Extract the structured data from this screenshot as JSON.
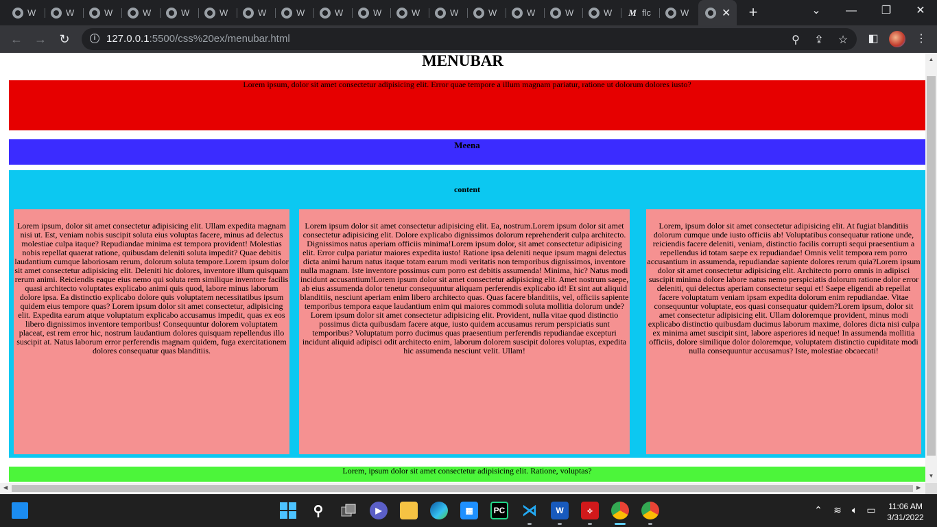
{
  "browser": {
    "tabs": [
      {
        "label": "W",
        "icon": "globe-icon"
      },
      {
        "label": "W",
        "icon": "globe-icon"
      },
      {
        "label": "W",
        "icon": "globe-icon"
      },
      {
        "label": "W",
        "icon": "globe-icon"
      },
      {
        "label": "W",
        "icon": "globe-icon"
      },
      {
        "label": "W",
        "icon": "globe-icon"
      },
      {
        "label": "W",
        "icon": "globe-icon"
      },
      {
        "label": "W",
        "icon": "globe-icon"
      },
      {
        "label": "W",
        "icon": "globe-icon"
      },
      {
        "label": "W",
        "icon": "globe-icon"
      },
      {
        "label": "W",
        "icon": "globe-icon"
      },
      {
        "label": "W",
        "icon": "globe-icon"
      },
      {
        "label": "W",
        "icon": "globe-icon"
      },
      {
        "label": "W",
        "icon": "globe-icon"
      },
      {
        "label": "W",
        "icon": "globe-icon"
      },
      {
        "label": "W",
        "icon": "globe-icon"
      },
      {
        "label": "flc",
        "icon": "m-logo-icon",
        "icon_text": "M"
      },
      {
        "label": "W",
        "icon": "globe-icon"
      }
    ],
    "active_tab": {
      "icon": "globe-icon",
      "close": "✕"
    },
    "new_tab": "+",
    "url_host": "127.0.0.1",
    "url_rest": ":5500/css%20ex/menubar.html"
  },
  "page": {
    "title": "MENUBAR",
    "header_text": "Lorem ipsum, dolor sit amet consectetur adipisicing elit. Error quae tempore a illum magnam pariatur, ratione ut dolorum dolores iusto?",
    "nav_text": "Meena",
    "content_heading": "content",
    "columns": [
      "Lorem ipsum, dolor sit amet consectetur adipisicing elit. Ullam expedita magnam nisi ut. Est, veniam nobis suscipit soluta eius voluptas facere, minus ad delectus molestiae culpa itaque? Repudiandae minima est tempora provident! Molestias nobis repellat quaerat ratione, quibusdam deleniti soluta impedit? Quae debitis laudantium cumque laboriosam rerum, dolorum soluta tempore.Lorem ipsum dolor sit amet consectetur adipisicing elit. Deleniti hic dolores, inventore illum quisquam rerum animi. Reiciendis eaque eius nemo qui soluta rem similique inventore facilis quasi architecto voluptates explicabo animi quis quod, labore minus laborum dolore ipsa. Ea distinctio explicabo dolore quis voluptatem necessitatibus ipsum quidem eius tempore quas? Lorem ipsum dolor sit amet consectetur, adipisicing elit. Expedita earum atque voluptatum explicabo accusamus impedit, quas ex eos libero dignissimos inventore temporibus! Consequuntur dolorem voluptatem placeat, est rem error hic, nostrum laudantium dolores quisquam repellendus illo suscipit at. Natus laborum error perferendis magnam quidem, fuga exercitationem dolores consequatur quas blanditiis.",
      "Lorem ipsum dolor sit amet consectetur adipisicing elit. Ea, nostrum.Lorem ipsum dolor sit amet consectetur adipisicing elit. Dolore explicabo dignissimos dolorum reprehenderit culpa architecto. Dignissimos natus aperiam officiis minima!Lorem ipsum dolor, sit amet consectetur adipisicing elit. Error culpa pariatur maiores expedita iusto! Ratione ipsa deleniti neque ipsum magni delectus dicta animi harum natus itaque totam earum modi veritatis non temporibus dignissimos, inventore nulla magnam. Iste inventore possimus cum porro est debitis assumenda! Minima, hic? Natus modi incidunt accusantium!Lorem ipsum dolor sit amet consectetur adipisicing elit. Amet nostrum saepe, ab eius assumenda dolor tenetur consequuntur aliquam perferendis explicabo id! Et sint aut aliquid blanditiis, nesciunt aperiam enim libero architecto quas. Quas facere blanditiis, vel, officiis sapiente temporibus tempora eaque laudantium enim qui maiores commodi soluta mollitia dolorum unde?Lorem ipsum dolor sit amet consectetur adipisicing elit. Provident, nulla vitae quod distinctio possimus dicta quibusdam facere atque, iusto quidem accusamus rerum perspiciatis sunt temporibus? Voluptatum porro ducimus quas praesentium perferendis repudiandae excepturi incidunt aliquid adipisci odit architecto enim, laborum dolorem suscipit dolores voluptas, expedita hic assumenda nesciunt velit. Ullam!",
      "Lorem, ipsum dolor sit amet consectetur adipisicing elit. At fugiat blanditiis dolorum cumque unde iusto officiis ab! Voluptatibus consequatur ratione unde, reiciendis facere deleniti, veniam, distinctio facilis corrupti sequi praesentium a repellendus id totam saepe ex repudiandae! Omnis velit tempora rem porro accusantium in assumenda, repudiandae sapiente dolores rerum quia?Lorem ipsum dolor sit amet consectetur adipisicing elit. Architecto porro omnis in adipisci suscipit minima dolore labore natus nemo perspiciatis dolorum ratione dolor error deleniti, qui delectus aperiam consectetur sequi et! Saepe eligendi ab repellat facere voluptatum veniam ipsam expedita dolorum enim repudiandae. Vitae consequuntur voluptate, eos quasi consequatur quidem?Lorem ipsum, dolor sit amet consectetur adipisicing elit. Ullam doloremque provident, minus modi explicabo distinctio quibusdam ducimus laborum maxime, dolores dicta nisi culpa ex minima amet suscipit sint, labore asperiores id neque! In assumenda mollitia officiis, dolore similique dolor doloremque, voluptatem distinctio cupiditate modi nulla consequuntur accusamus? Iste, molestiae obcaecati!"
    ],
    "footer_text": "Lorem, ipsum dolor sit amet consectetur adipisicing elit. Ratione, voluptas?",
    "colors": {
      "header": "#e60000",
      "nav": "#3b2cff",
      "content": "#0cc8f1",
      "column": "#f59191",
      "footer": "#4cf53a"
    }
  },
  "taskbar": {
    "time": "11:06 AM",
    "date": "3/31/2022",
    "apps": [
      "start-icon",
      "search-icon",
      "task-view-icon",
      "chat-icon",
      "file-explorer-icon",
      "edge-icon",
      "store-icon",
      "pycharm-icon",
      "vscode-icon",
      "word-icon",
      "acrobat-icon",
      "chrome-icon",
      "chrome-profile-icon"
    ],
    "pycharm_text": "PC",
    "word_text": "W"
  }
}
